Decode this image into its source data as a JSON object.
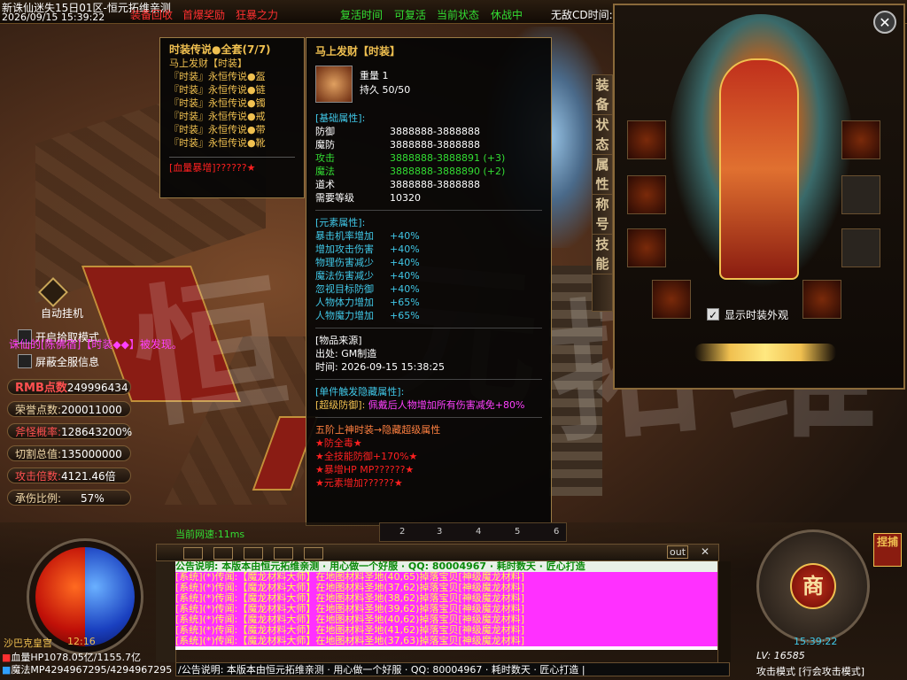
{
  "topbar": {
    "server": "新诛仙迷失15日01区-恒元拓维亲测",
    "datetime": "2026/09/15 15:39:22",
    "menu_red": [
      "装备回收",
      "首爆奖励",
      "狂暴之力"
    ],
    "menu_green": [
      "复活时间",
      "可复活",
      "当前状态",
      "休战中"
    ],
    "cd_label": "无敌CD时间:"
  },
  "left_options": {
    "auto_hang": "自动挂机",
    "pickup_mode": "开启拾取模式",
    "hide_info": "屏蔽全服信息"
  },
  "announce": "诛仙的[陈佛宿]【时装◆◆】被发现。",
  "stats": [
    {
      "label": "RMB点数",
      "value": "249996434"
    },
    {
      "label": "荣誉点数:",
      "value": "200011000"
    },
    {
      "label": "斧怪概率:",
      "value": "128643200%"
    },
    {
      "label": "切割总值:",
      "value": "135000000"
    },
    {
      "label": "攻击倍数:",
      "value": "4121.46倍"
    },
    {
      "label": "承伤比例:",
      "value": "57%"
    }
  ],
  "set_tooltip": {
    "title": "时装传说●全套(7/7)",
    "subtitle": "马上发财【时装】",
    "items": [
      "『时装』永恒传说●盔",
      "『时装』永恒传说●链",
      "『时装』永恒传说●镯",
      "『时装』永恒传说●戒",
      "『时装』永恒传说●带",
      "『时装』永恒传说●靴"
    ],
    "hidden": "[血量暴增]??????★"
  },
  "item_tooltip": {
    "title": "马上发财【时装】",
    "weight_label": "重量",
    "weight": "1",
    "durability_label": "持久",
    "durability": "50/50",
    "base_header": "[基础属性]:",
    "base_attrs": [
      {
        "k": "防御",
        "v": "3888888-3888888",
        "c": "#ffffff"
      },
      {
        "k": "魔防",
        "v": "3888888-3888888",
        "c": "#ffffff"
      },
      {
        "k": "攻击",
        "v": "3888888-3888891 (+3)",
        "c": "#33dd33"
      },
      {
        "k": "魔法",
        "v": "3888888-3888890 (+2)",
        "c": "#33dd33"
      },
      {
        "k": "道术",
        "v": "3888888-3888888",
        "c": "#ffffff"
      },
      {
        "k": "需要等级",
        "v": "10320",
        "c": "#ffffff"
      }
    ],
    "elem_header": "[元素属性]:",
    "elem_attrs": [
      {
        "k": "暴击机率增加",
        "v": "+40%"
      },
      {
        "k": "增加攻击伤害",
        "v": "+40%"
      },
      {
        "k": "物理伤害减少",
        "v": "+40%"
      },
      {
        "k": "魔法伤害减少",
        "v": "+40%"
      },
      {
        "k": "忽视目标防御",
        "v": "+40%"
      },
      {
        "k": "人物体力增加",
        "v": "+65%"
      },
      {
        "k": "人物魔力增加",
        "v": "+65%"
      }
    ],
    "source_header": "[物品来源]",
    "source_from": "出处: GM制造",
    "source_time_label": "时间:",
    "source_time": "2026-09-15 15:38:25",
    "trigger_header": "[单件触发隐藏属性]:",
    "trigger_line_a": "[超级防御]:",
    "trigger_line_b": "佩戴后人物增加所有伤害减免",
    "trigger_line_c": "+80%",
    "tier_header": "五阶上神时装→隐藏超级属性",
    "tier_lines": [
      "★防全毒★",
      "★全技能防御+170%★",
      "★暴增HP MP??????★",
      "★元素增加??????★"
    ]
  },
  "panel": {
    "side_tabs": [
      "装备",
      "状态",
      "属性",
      "称号",
      "技能"
    ],
    "show_fashion": "显示时装外观"
  },
  "bottom": {
    "net_speed": "当前网速:11ms",
    "hotkeys": [
      "2",
      "3",
      "4",
      "5",
      "6"
    ],
    "out_label": "out",
    "notice": "公告说明: 本版本由恒元拓维亲测 · 用心做一个好服 · QQ: 80004967 · 耗时数天 · 匠心打造",
    "chat_lines": [
      "[系统](*)传闻:【魔龙材料大师】在地图材料圣地(40,65)掉落宝贝[神级魔龙材料]",
      "[系统](*)传闻:【魔龙材料大师】在地图材料圣地(37,62)掉落宝贝[神级魔龙材料]",
      "[系统](*)传闻:【魔龙材料大师】在地图材料圣地(38,62)掉落宝贝[神级魔龙材料]",
      "[系统](*)传闻:【魔龙材料大师】在地图材料圣地(39,62)掉落宝贝[神级魔龙材料]",
      "[系统](*)传闻:【魔龙材料大师】在地图材料圣地(40,62)掉落宝贝[神级魔龙材料]",
      "[系统](*)传闻:【魔龙材料大师】在地图材料圣地(41,62)掉落宝贝[神级魔龙材料]",
      "[系统](*)传闻:【魔龙材料大师】在地图材料圣地(37,63)掉落宝贝[神级魔龙材料]"
    ],
    "input_text": "/公告说明: 本版本由恒元拓维亲测 · 用心做一个好服 · QQ: 80004967 · 耗时数天 · 匠心打造 |",
    "map_name": "沙巴克皇宫",
    "map_time": "12:16",
    "hp_label": "血量HP",
    "hp": "1078.05亿/1155.7亿",
    "mp_label": "魔法MP",
    "mp": "4294967295/4294967295",
    "shop_label": "商",
    "tag_label": "捏捕",
    "clock": "15:39:22",
    "level": "LV: 16585",
    "attack_mode": "攻击模式",
    "attack_mode_value": "[行会攻击模式]"
  },
  "colors": {
    "gold": "#f0c050",
    "cyan": "#40c8e8",
    "green": "#33dd33",
    "red": "#ff2020",
    "magenta": "#ff40ff",
    "yellow": "#ffff40"
  }
}
